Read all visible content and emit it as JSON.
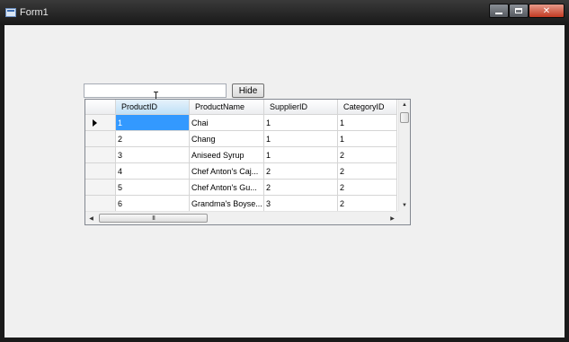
{
  "window": {
    "title": "Form1"
  },
  "toolbar": {
    "textbox_value": "",
    "hide_label": "Hide"
  },
  "grid": {
    "columns": [
      "ProductID",
      "ProductName",
      "SupplierID",
      "CategoryID"
    ],
    "selected_row": 0,
    "rows": [
      [
        "1",
        "Chai",
        "1",
        "1"
      ],
      [
        "2",
        "Chang",
        "1",
        "1"
      ],
      [
        "3",
        "Aniseed Syrup",
        "1",
        "2"
      ],
      [
        "4",
        "Chef Anton's Caj...",
        "2",
        "2"
      ],
      [
        "5",
        "Chef Anton's Gu...",
        "2",
        "2"
      ],
      [
        "6",
        "Grandma's Boyse...",
        "3",
        "2"
      ]
    ],
    "hscroll_thumb_glyph": "III"
  },
  "colors": {
    "selection": "#3399ff",
    "close_button": "#c23a22"
  }
}
